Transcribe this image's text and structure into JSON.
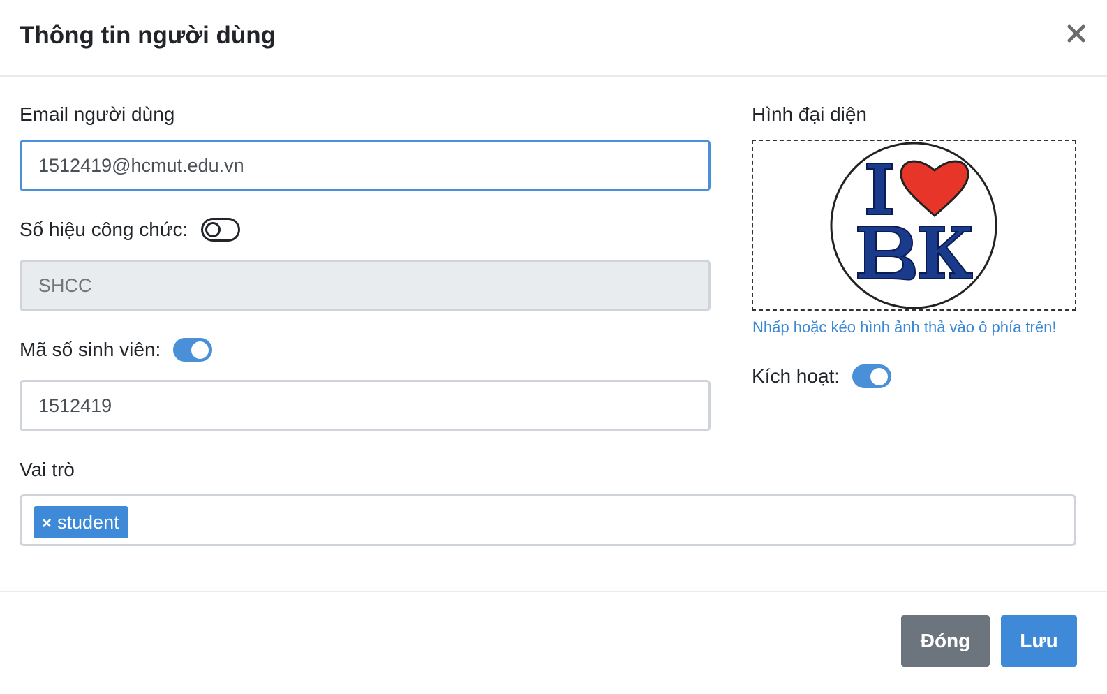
{
  "modal": {
    "title": "Thông tin người dùng",
    "close_icon": "close-icon"
  },
  "email": {
    "label": "Email người dùng",
    "value": "1512419@hcmut.edu.vn"
  },
  "shcc": {
    "label": "Số hiệu công chức:",
    "toggle_on": false,
    "placeholder": "SHCC"
  },
  "mssv": {
    "label": "Mã số sinh viên:",
    "toggle_on": true,
    "value": "1512419"
  },
  "roles": {
    "label": "Vai trò",
    "items": [
      {
        "remove_symbol": "×",
        "label": "student"
      }
    ]
  },
  "avatar": {
    "label": "Hình đại diện",
    "image_logo_text": "I ♥ BK",
    "hint": "Nhấp hoặc kéo hình ảnh thả vào ô phía trên!"
  },
  "active": {
    "label": "Kích hoạt:",
    "toggle_on": true
  },
  "footer": {
    "close_label": "Đóng",
    "save_label": "Lưu"
  },
  "colors": {
    "primary": "#3f8ad8",
    "secondary": "#6c757d",
    "heart": "#e8352a",
    "logo_text": "#1a3a8c"
  }
}
